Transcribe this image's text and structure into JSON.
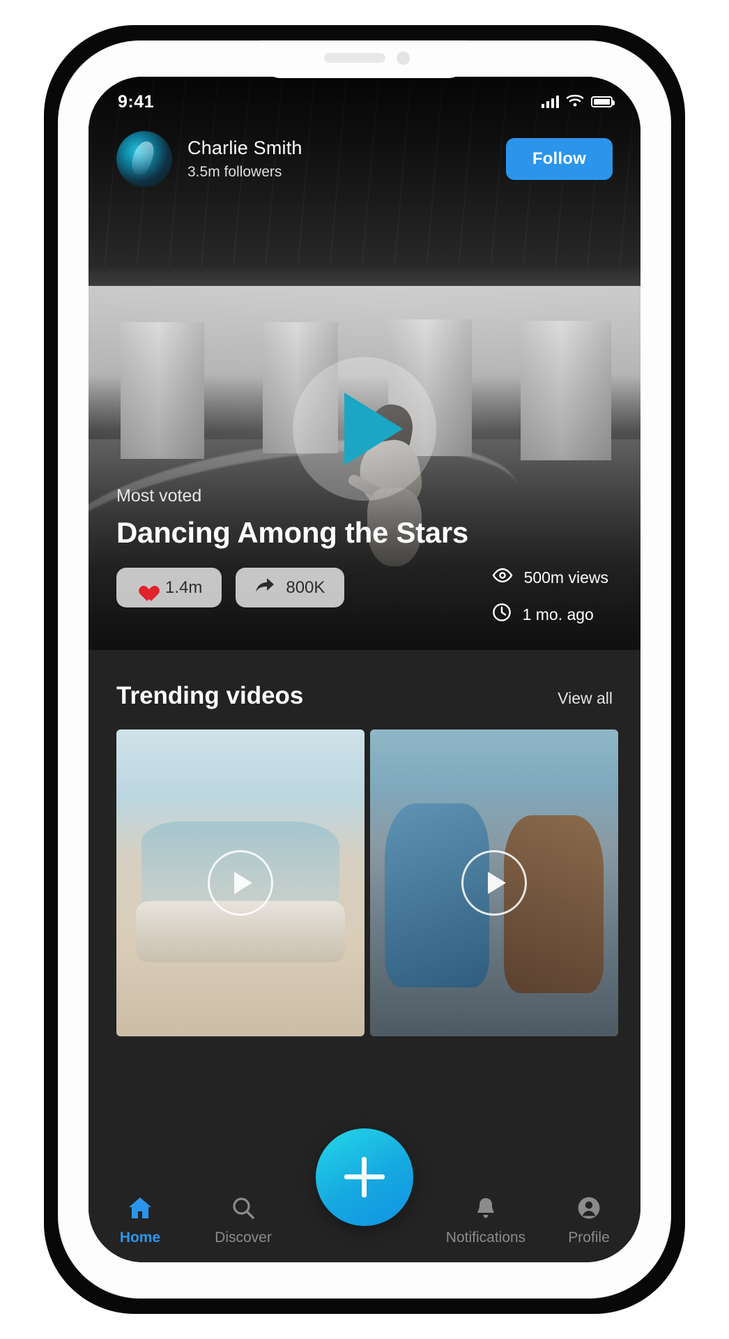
{
  "status_bar": {
    "time": "9:41",
    "signal_icon": "signal-bars-icon",
    "wifi_icon": "wifi-icon",
    "battery_icon": "battery-icon"
  },
  "profile": {
    "avatar_icon": "user-avatar",
    "name": "Charlie Smith",
    "followers": "3.5m followers",
    "follow_label": "Follow"
  },
  "hero": {
    "play_icon": "play-icon",
    "kicker": "Most voted",
    "title": "Dancing Among the Stars",
    "likes": {
      "icon": "heart-icon",
      "value": "1.4m"
    },
    "shares": {
      "icon": "share-arrow-icon",
      "value": "800K"
    },
    "views": {
      "icon": "eye-icon",
      "value": "500m views"
    },
    "age": {
      "icon": "clock-icon",
      "value": "1 mo. ago"
    }
  },
  "trending": {
    "title": "Trending videos",
    "view_all": "View all",
    "cards": [
      {
        "name": "beach-band-video",
        "play_icon": "play-circle-icon"
      },
      {
        "name": "party-friends-video",
        "play_icon": "play-circle-icon"
      }
    ]
  },
  "tabbar": {
    "items": [
      {
        "label": "Home",
        "icon": "home-icon",
        "active": true
      },
      {
        "label": "Discover",
        "icon": "search-icon",
        "active": false
      },
      {
        "label": "Notifications",
        "icon": "bell-icon",
        "active": false
      },
      {
        "label": "Profile",
        "icon": "person-circle-icon",
        "active": false
      }
    ],
    "fab_icon": "plus-icon"
  },
  "colors": {
    "accent_blue": "#2b95ec",
    "play_teal": "#1ba7c4",
    "heart_red": "#e1222b",
    "surface_dark": "#232323"
  }
}
